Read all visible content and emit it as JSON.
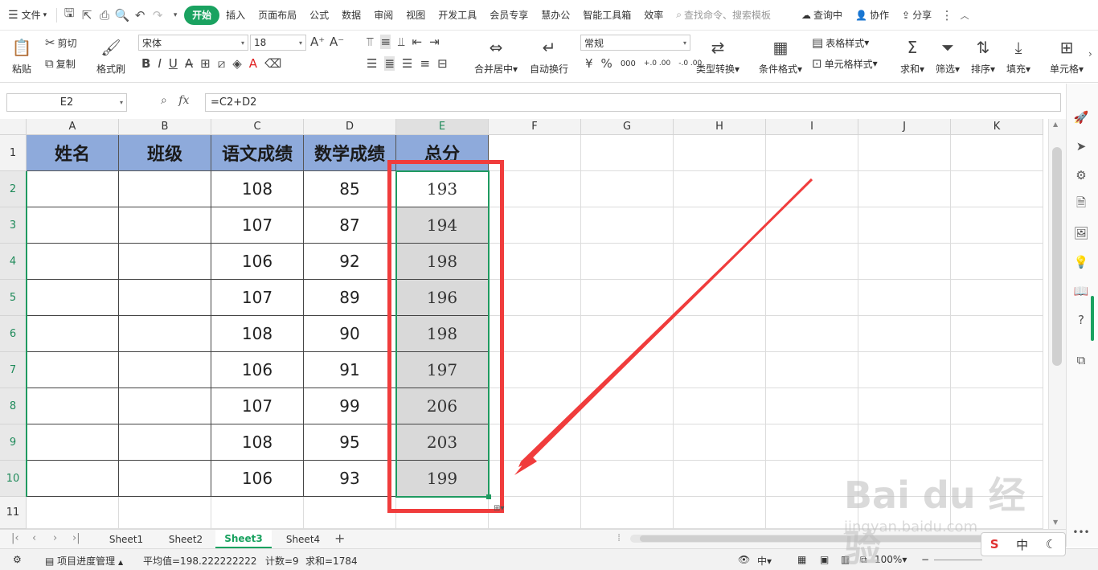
{
  "menubar": {
    "file": "文件",
    "tabs": [
      "开始",
      "插入",
      "页面布局",
      "公式",
      "数据",
      "审阅",
      "视图",
      "开发工具",
      "会员专享",
      "慧办公",
      "智能工具箱",
      "效率"
    ],
    "search_placeholder": "查找命令、搜索模板",
    "query": "查询中",
    "collab": "协作",
    "share": "分享"
  },
  "ribbon": {
    "paste": "粘贴",
    "cut": "剪切",
    "copy": "复制",
    "format_painter": "格式刷",
    "font_name": "宋体",
    "font_size": "18",
    "merge_center": "合并居中",
    "wrap_text": "自动换行",
    "number_format": "常规",
    "type_convert": "类型转换",
    "cond_format": "条件格式",
    "table_style": "表格样式",
    "cell_style": "单元格样式",
    "sum": "求和",
    "filter": "筛选",
    "sort": "排序",
    "fill": "填充",
    "cell": "单元格",
    "currency": "¥",
    "percent": "%",
    "thousands": "000",
    "dec_inc": "+.0 .00",
    "dec_dec": "-.0 .00"
  },
  "formula_bar": {
    "name_box": "E2",
    "fx": "fx",
    "formula": "=C2+D2"
  },
  "grid": {
    "columns": [
      "A",
      "B",
      "C",
      "D",
      "E",
      "F",
      "G",
      "H",
      "I",
      "J",
      "K"
    ],
    "rows": [
      "1",
      "2",
      "3",
      "4",
      "5",
      "6",
      "7",
      "8",
      "9",
      "10",
      "11"
    ],
    "header_row": [
      "姓名",
      "班级",
      "语文成绩",
      "数学成绩",
      "总分"
    ],
    "data": [
      {
        "chinese": "108",
        "math": "85",
        "total": "193"
      },
      {
        "chinese": "107",
        "math": "87",
        "total": "194"
      },
      {
        "chinese": "106",
        "math": "92",
        "total": "198"
      },
      {
        "chinese": "107",
        "math": "89",
        "total": "196"
      },
      {
        "chinese": "108",
        "math": "90",
        "total": "198"
      },
      {
        "chinese": "106",
        "math": "91",
        "total": "197"
      },
      {
        "chinese": "107",
        "math": "99",
        "total": "206"
      },
      {
        "chinese": "108",
        "math": "95",
        "total": "203"
      },
      {
        "chinese": "106",
        "math": "93",
        "total": "199"
      }
    ]
  },
  "sheets": {
    "tabs": [
      "Sheet1",
      "Sheet2",
      "Sheet3",
      "Sheet4"
    ],
    "active": "Sheet3"
  },
  "status": {
    "project": "项目进度管理",
    "average": "平均值=198.222222222",
    "count": "计数=9",
    "sum": "求和=1784",
    "zoom": "100%",
    "ime": "中"
  },
  "watermark": {
    "line1": "Bai du 经验",
    "line2": "jingyan.baidu.com"
  },
  "colors": {
    "accent": "#1aa260",
    "header_fill": "#8eaadb",
    "selection_fill": "#d9d9d9",
    "annotation_red": "#f03c3c"
  }
}
